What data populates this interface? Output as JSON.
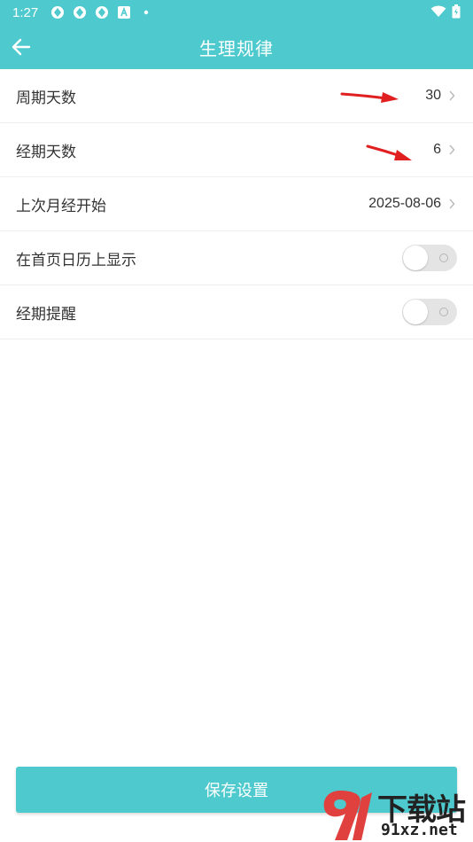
{
  "status_bar": {
    "time": "1:27",
    "icons": [
      "app-notification-icon",
      "app-notification-icon",
      "app-notification-icon",
      "font-a-icon",
      "dot-icon"
    ],
    "right_icons": [
      "wifi-icon",
      "battery-icon"
    ]
  },
  "app_bar": {
    "title": "生理规律",
    "back_icon": "arrow-left-icon"
  },
  "settings": {
    "cycle_days": {
      "label": "周期天数",
      "value": "30"
    },
    "period_days": {
      "label": "经期天数",
      "value": "6"
    },
    "last_period_start": {
      "label": "上次月经开始",
      "value": "2025-08-06"
    },
    "show_on_calendar": {
      "label": "在首页日历上显示",
      "enabled": false
    },
    "period_reminder": {
      "label": "经期提醒",
      "enabled": false
    }
  },
  "save_button": {
    "label": "保存设置"
  },
  "watermark": {
    "logo_text": "下载站",
    "domain_text": "91xz.net"
  },
  "colors": {
    "primary": "#4ECACE",
    "annotation_arrow": "#E02020"
  }
}
